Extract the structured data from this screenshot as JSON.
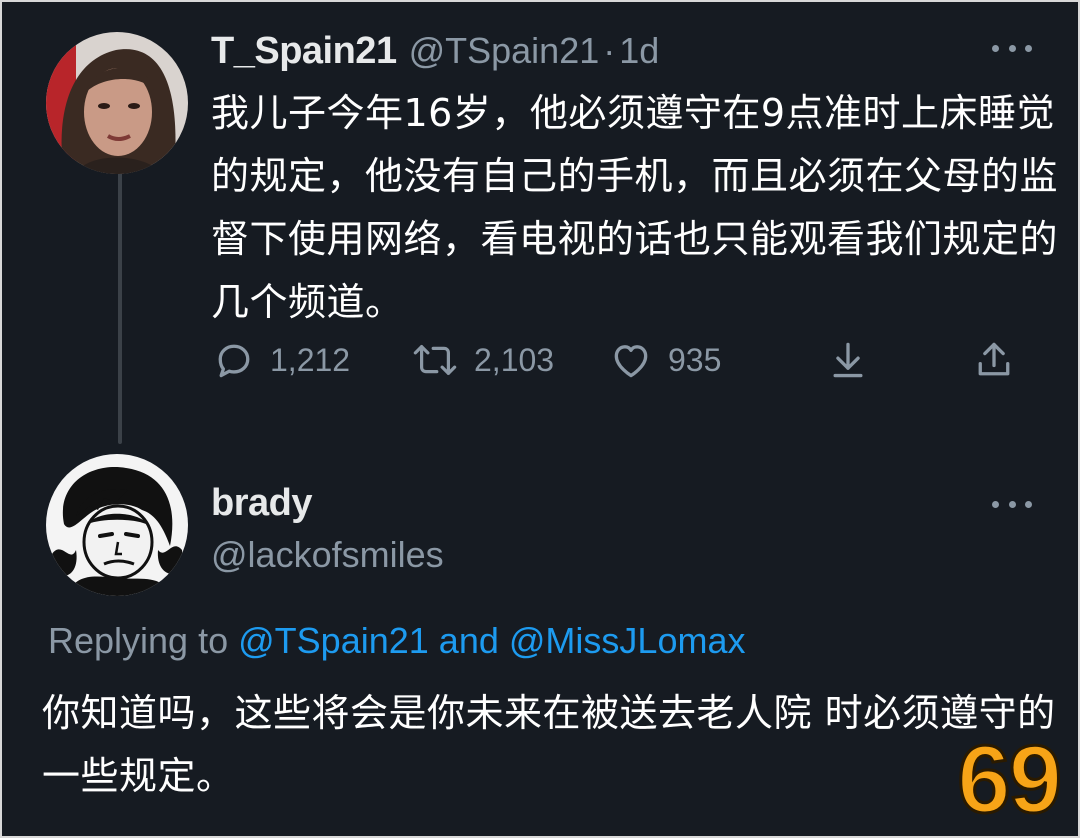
{
  "tweet": {
    "author_name": "T_Spain21",
    "author_handle": "@TSpain21",
    "separator": "·",
    "time": "1d",
    "text": "我儿子今年16岁，他必须遵守在9点准时上床睡觉的规定，他没有自己的手机，而且必须在父母的监督下使用网络，看电视的话也只能观看我们规定的几个频道。",
    "replies": "1,212",
    "retweets": "2,103",
    "likes": "935",
    "icons": [
      "reply-icon",
      "retweet-icon",
      "like-icon",
      "download-icon",
      "share-icon",
      "more-icon"
    ]
  },
  "reply": {
    "author_name": "brady",
    "author_handle": "@lackofsmiles",
    "replying_prefix": "Replying to",
    "mention1": "@TSpain21",
    "conjunction": "and",
    "mention2": "@MissJLomax",
    "text": "你知道吗，这些将会是你未来在被送去老人院 时必须遵守的一些规定。"
  },
  "badge": {
    "number": "69",
    "color": "#f7a417"
  },
  "colors": {
    "background": "#161b22",
    "muted": "#8b98a5",
    "link": "#1d9bf0",
    "text": "#ffffff"
  }
}
